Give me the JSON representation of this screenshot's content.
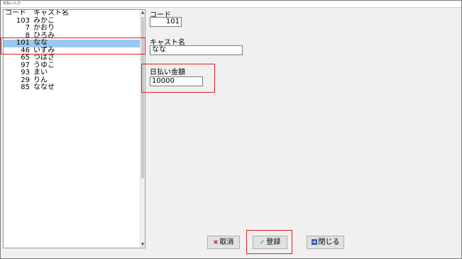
{
  "window": {
    "title": "日払い入力"
  },
  "list": {
    "header": {
      "code": "コード",
      "name": "キャスト名"
    },
    "rows": [
      {
        "code": "103",
        "name": "みかこ"
      },
      {
        "code": "7",
        "name": "かおり"
      },
      {
        "code": "8",
        "name": "ひろみ"
      },
      {
        "code": "101",
        "name": "なな"
      },
      {
        "code": "46",
        "name": "いずみ"
      },
      {
        "code": "65",
        "name": "つばさ"
      },
      {
        "code": "97",
        "name": "うゆこ"
      },
      {
        "code": "93",
        "name": "まい"
      },
      {
        "code": "29",
        "name": "りん"
      },
      {
        "code": "85",
        "name": "ななせ"
      }
    ],
    "selected_code": "101"
  },
  "form": {
    "code_label": "コード",
    "code_value": "101",
    "cast_label": "キャスト名",
    "cast_value": "なな",
    "amount_label": "日払い金額",
    "amount_value": "10000"
  },
  "buttons": {
    "cancel": "取消",
    "register": "登録",
    "close": "閉じる"
  },
  "icons": {
    "cancel": "x-icon",
    "register": "check-icon",
    "close": "close-door-icon"
  },
  "colors": {
    "selection": "#99c9ef",
    "highlight_box": "#e02020"
  }
}
